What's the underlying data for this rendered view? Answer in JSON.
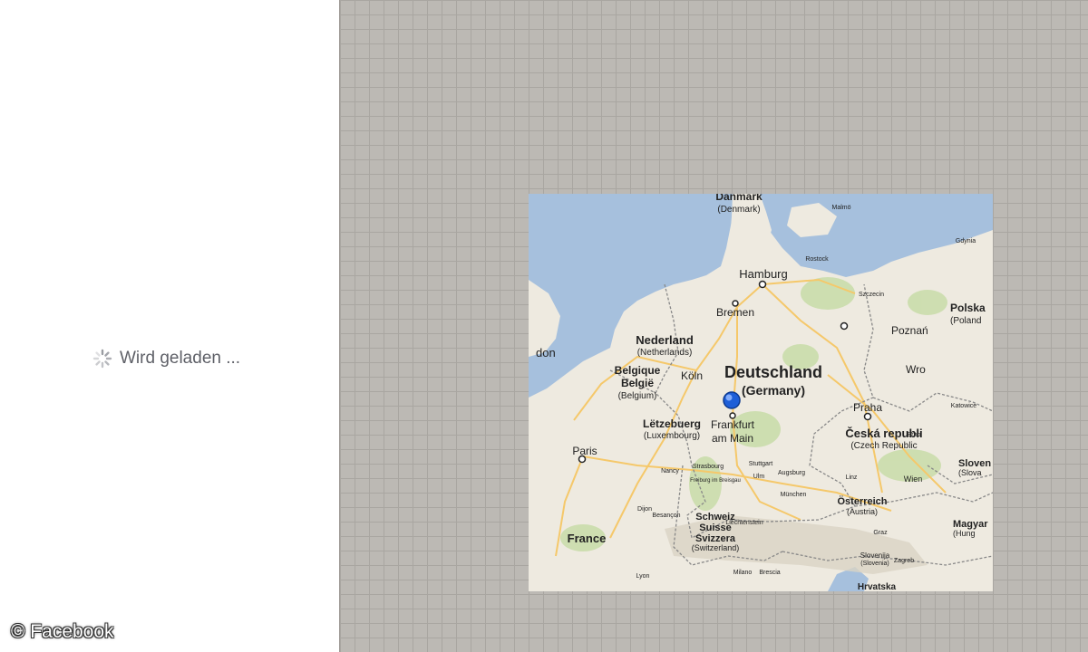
{
  "loading": {
    "icon": "spinner-icon",
    "text": "Wird geladen ..."
  },
  "credit": {
    "text": "© Facebook"
  },
  "map": {
    "colors": {
      "water": "#a6c0dd",
      "land": "#eeeae0",
      "green": "#c8dca8",
      "road": "#f5c86a",
      "border": "#777777",
      "marker": "#1e5fd8"
    },
    "countries": {
      "denmark": "Danmark",
      "denmark_en": "(Denmark)",
      "netherlands": "Nederland",
      "netherlands_en": "(Netherlands)",
      "belgium_fr": "Belgique",
      "belgium_nl": "België",
      "belgium_en": "(Belgium)",
      "luxembourg": "Lëtzebuerg",
      "luxembourg_en": "(Luxembourg)",
      "germany": "Deutschland",
      "germany_en": "(Germany)",
      "czech": "Česká republi",
      "czech_en": "(Czech Republic",
      "poland": "Polska",
      "poland_en": "(Poland",
      "france": "France",
      "switzerland_de": "Schweiz",
      "switzerland_fr": "Suisse",
      "switzerland_it": "Svizzera",
      "switzerland_en": "(Switzerland)",
      "austria": "Österreich",
      "austria_en": "(Austria)",
      "slovakia": "Sloven",
      "slovakia_en": "(Slova",
      "hungary": "Magyar",
      "hungary_en": "(Hung",
      "croatia": "Hrvatska",
      "slovenia": "Slovenija",
      "slovenia_en": "(Slovenia)",
      "liechtenstein": "Liechtenstein"
    },
    "cities": {
      "hamburg": "Hamburg",
      "bremen": "Bremen",
      "koeln": "Köln",
      "frankfurt1": "Frankfurt",
      "frankfurt2": "am Main",
      "paris": "Paris",
      "praha": "Praha",
      "poznan": "Poznań",
      "wroclaw": "Wro",
      "london_part": "don",
      "rostock": "Rostock",
      "szczecin": "Szczecin",
      "strasbourg": "Strasbourg",
      "stuttgart": "Stuttgart",
      "muenchen": "München",
      "nancy": "Nancy",
      "milano": "Milano",
      "lyon": "Lyon",
      "besancon": "Besançon",
      "dijon": "Dijon",
      "freiburg": "Freiburg im Breisgau",
      "augsburg": "Augsburg",
      "ulm": "Ulm",
      "brescia": "Brescia",
      "linz": "Linz",
      "wien": "Wien",
      "graz": "Graz",
      "zagreb": "Zagreb",
      "brno": "Brno",
      "katowice": "Katowice",
      "gdynia": "Gdynia",
      "malmo": "Malmö"
    }
  }
}
